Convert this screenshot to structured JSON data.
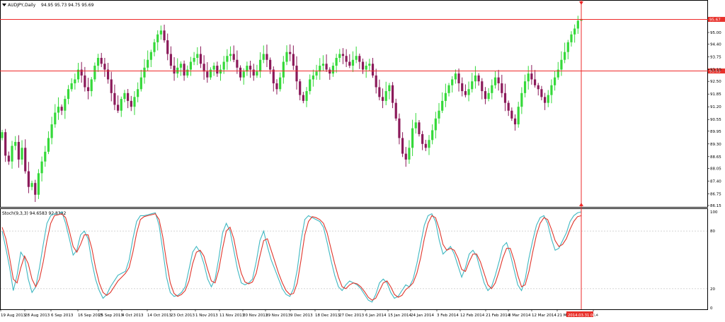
{
  "colors": {
    "bull": "#35d93a",
    "bear": "#8b1a5a",
    "hline": "#ee2a2a",
    "stoch_main": "#3fb8c2",
    "stoch_signal": "#e0362c",
    "frame": "#000000",
    "grid": "#cfcfcf",
    "tag_bg": "#e8312b"
  },
  "price_header": {
    "symbol_text": "AUDJPY,Daily",
    "ohlc_text": "94.95 95.73 94.75 95.69",
    "dropdown_icon": "triangle-down-icon"
  },
  "stoch_header": {
    "text": "Stoch(9,3,3) 94.6583 92.8392"
  },
  "chart_data": [
    {
      "type": "candlestick",
      "ylim": [
        86.15,
        96.3
      ],
      "y_ticks": [
        "95.00",
        "94.40",
        "93.75",
        "93.10",
        "92.50",
        "91.85",
        "91.20",
        "90.55",
        "89.95",
        "89.30",
        "88.65",
        "88.05",
        "87.40",
        "86.75",
        "86.15"
      ],
      "y_tick_values": [
        95.0,
        94.4,
        93.75,
        93.1,
        92.5,
        91.85,
        91.2,
        90.55,
        89.95,
        89.3,
        88.65,
        88.05,
        87.4,
        86.75,
        86.15
      ],
      "hlines": [
        {
          "value": 95.67,
          "label": "95.67"
        },
        {
          "value": 93.03,
          "label": "93.03"
        }
      ],
      "close_series": [
        89.9,
        88.7,
        88.4,
        89.2,
        89.4,
        88.5,
        89.1,
        87.9,
        87.1,
        87.3,
        86.7,
        87.8,
        88.4,
        88.9,
        89.6,
        90.3,
        90.9,
        91.2,
        91.0,
        91.6,
        92.1,
        92.4,
        92.6,
        93.1,
        92.8,
        92.2,
        92.0,
        92.6,
        93.3,
        93.7,
        93.4,
        93.1,
        92.6,
        91.9,
        91.3,
        91.0,
        91.6,
        91.9,
        91.5,
        91.2,
        91.7,
        92.1,
        92.7,
        93.2,
        93.6,
        94.0,
        94.5,
        94.9,
        95.1,
        94.6,
        93.9,
        93.3,
        92.9,
        93.2,
        93.4,
        92.8,
        93.1,
        93.5,
        93.7,
        93.9,
        93.4,
        93.0,
        92.7,
        93.1,
        93.3,
        92.9,
        93.1,
        93.5,
        93.8,
        93.9,
        93.6,
        93.2,
        92.7,
        93.0,
        93.3,
        93.1,
        92.8,
        93.0,
        93.6,
        93.9,
        93.6,
        93.1,
        92.4,
        92.1,
        92.7,
        93.5,
        94.0,
        93.9,
        93.3,
        92.5,
        91.8,
        91.5,
        92.0,
        92.6,
        92.8,
        93.0,
        93.3,
        93.4,
        93.1,
        92.9,
        93.3,
        93.7,
        93.9,
        93.8,
        93.5,
        93.3,
        93.6,
        93.8,
        93.5,
        93.1,
        93.3,
        93.4,
        92.8,
        92.2,
        91.7,
        91.5,
        92.0,
        92.3,
        91.4,
        90.6,
        89.6,
        88.8,
        88.5,
        89.1,
        90.1,
        90.4,
        89.8,
        89.3,
        89.1,
        89.5,
        90.0,
        90.6,
        91.0,
        91.5,
        91.9,
        92.3,
        92.6,
        92.9,
        92.4,
        92.0,
        91.8,
        92.1,
        92.5,
        92.8,
        92.5,
        92.0,
        91.6,
        91.9,
        92.3,
        92.7,
        92.4,
        91.9,
        91.4,
        91.0,
        90.6,
        90.3,
        91.2,
        91.9,
        92.5,
        92.9,
        92.6,
        92.3,
        92.1,
        91.7,
        91.4,
        91.8,
        92.3,
        92.7,
        93.1,
        93.6,
        94.0,
        94.5,
        94.9,
        95.2,
        95.6,
        95.69
      ],
      "x_labels": [
        "19 Aug 2013",
        "28 Aug 2013",
        "6 Sep 2013",
        "16 Sep 2013",
        "25 Sep 2013",
        "4 Oct 2013",
        "14 Oct 2013",
        "23 Oct 2013",
        "1 Nov 2013",
        "11 Nov 2013",
        "20 Nov 2013",
        "29 Nov 2013",
        "9 Dec 2013",
        "18 Dec 2013",
        "27 Dec 2013",
        "6 Jan 2014",
        "15 Jan 2014",
        "24 Jan 2014",
        "3 Feb 2014",
        "12 Feb 2014",
        "21 Feb 2014",
        "3 Mar 2014",
        "12 Mar 2014",
        "21 Ma",
        "2014.03.31 00:00",
        "14"
      ],
      "cursor_time_label": "2014.03.31 00:00"
    },
    {
      "type": "line",
      "ylim": [
        0,
        100
      ],
      "y_ticks": [
        "100",
        "80",
        "20",
        "0"
      ],
      "y_tick_values": [
        100,
        80,
        20,
        0
      ],
      "level_lines": [
        80,
        20
      ],
      "series": [
        {
          "name": "main",
          "values": [
            80,
            62,
            42,
            18,
            34,
            58,
            52,
            30,
            16,
            22,
            42,
            66,
            88,
            96,
            98,
            97,
            100,
            88,
            72,
            55,
            60,
            76,
            80,
            72,
            48,
            30,
            18,
            10,
            14,
            22,
            28,
            34,
            36,
            38,
            50,
            72,
            90,
            96,
            96,
            97,
            98,
            99,
            86,
            60,
            32,
            16,
            12,
            13,
            16,
            22,
            40,
            58,
            64,
            58,
            46,
            30,
            22,
            30,
            52,
            78,
            88,
            80,
            60,
            40,
            26,
            24,
            26,
            30,
            48,
            70,
            80,
            64,
            50,
            40,
            30,
            20,
            14,
            12,
            20,
            40,
            70,
            92,
            96,
            94,
            92,
            90,
            84,
            68,
            50,
            34,
            22,
            18,
            24,
            28,
            26,
            24,
            20,
            14,
            8,
            6,
            14,
            26,
            30,
            26,
            16,
            10,
            12,
            18,
            24,
            22,
            30,
            46,
            66,
            86,
            96,
            98,
            90,
            70,
            56,
            60,
            64,
            56,
            44,
            32,
            42,
            56,
            60,
            54,
            40,
            26,
            18,
            22,
            34,
            48,
            64,
            68,
            56,
            40,
            24,
            18,
            30,
            52,
            70,
            86,
            94,
            96,
            88,
            72,
            60,
            62,
            70,
            78,
            90,
            96,
            99,
            100
          ]
        },
        {
          "name": "signal",
          "values": [
            84,
            72,
            52,
            30,
            26,
            42,
            54,
            46,
            30,
            22,
            30,
            48,
            70,
            88,
            96,
            97,
            98,
            94,
            80,
            64,
            58,
            66,
            76,
            76,
            62,
            42,
            26,
            16,
            13,
            16,
            22,
            28,
            32,
            36,
            42,
            58,
            78,
            92,
            95,
            96,
            97,
            98,
            92,
            74,
            48,
            26,
            15,
            12,
            14,
            18,
            28,
            46,
            58,
            60,
            54,
            40,
            28,
            26,
            40,
            62,
            80,
            84,
            72,
            52,
            36,
            27,
            25,
            27,
            36,
            54,
            70,
            72,
            60,
            48,
            36,
            26,
            18,
            14,
            15,
            26,
            50,
            76,
            90,
            95,
            94,
            92,
            88,
            78,
            62,
            46,
            32,
            22,
            20,
            24,
            26,
            25,
            22,
            17,
            11,
            8,
            10,
            18,
            26,
            28,
            22,
            14,
            11,
            13,
            19,
            22,
            26,
            36,
            52,
            72,
            88,
            96,
            94,
            82,
            66,
            60,
            62,
            60,
            52,
            40,
            38,
            48,
            56,
            56,
            48,
            36,
            24,
            20,
            26,
            38,
            52,
            62,
            62,
            50,
            34,
            22,
            24,
            38,
            58,
            76,
            88,
            94,
            92,
            82,
            70,
            64,
            66,
            72,
            82,
            90,
            95,
            96
          ]
        }
      ]
    }
  ]
}
